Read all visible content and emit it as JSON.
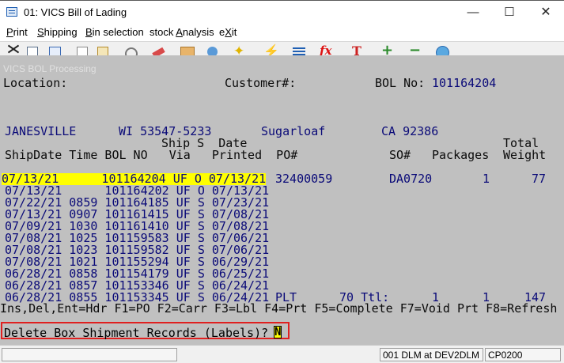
{
  "window": {
    "title": "01: VICS Bill of Lading",
    "minimize": "—",
    "maximize": "☐",
    "close": "✕"
  },
  "menu": {
    "print": {
      "acc": "P",
      "rest": "rint"
    },
    "shipping": {
      "acc": "S",
      "rest": "hipping"
    },
    "bin": {
      "acc": "B",
      "rest": "in selection"
    },
    "stock": {
      "pre": "stock ",
      "acc": "A",
      "rest": "nalysis"
    },
    "exit": {
      "pre": "e",
      "acc": "X",
      "rest": "it"
    }
  },
  "toolbar": [
    "scissors-icon",
    "copy-icon",
    "document-icon",
    "paste-icon",
    "clipboard-icon",
    "gear-icon",
    "eraser-icon",
    "box-icon",
    "users-icon",
    "star-icon",
    "bolt-icon",
    "lines-icon",
    "fx-icon",
    "text-icon",
    "plus-icon",
    "minus-icon",
    "globe-icon"
  ],
  "terminal": {
    "title": "VICS BOL Processing",
    "location_label": "Location:",
    "customer_label": "Customer#:",
    "bol_label": "BOL No:",
    "bol_value": "101164204",
    "from_city": "JANESVILLE",
    "from_state_zip": "WI 53547-5233",
    "to_name": "Sugarloaf",
    "to_state_zip": "CA 92386",
    "hdr_line1": "Ship S  Date",
    "hdr_total": "Total",
    "hdr_line2": "ShipDate Time BOL NO   Via   Printed  PO#",
    "hdr_so": "SO#",
    "hdr_packages": "Packages",
    "hdr_weight": "Weight",
    "rows": [
      {
        "text": "07/13/21      101164204 UF O 07/13/21",
        "po": "32400059",
        "so": "DA0720",
        "pkg": "1",
        "wt": "77"
      },
      {
        "text": "07/13/21      101164202 UF O 07/13/21"
      },
      {
        "text": "07/22/21 0859 101164185 UF S 07/23/21"
      },
      {
        "text": "07/13/21 0907 101161415 UF S 07/08/21"
      },
      {
        "text": "07/09/21 1030 101161410 UF S 07/08/21"
      },
      {
        "text": "07/08/21 1025 101159583 UF S 07/06/21"
      },
      {
        "text": "07/08/21 1023 101159582 UF S 07/06/21"
      },
      {
        "text": "07/08/21 1021 101155294 UF S 06/29/21"
      },
      {
        "text": "06/28/21 0858 101154179 UF S 06/25/21"
      },
      {
        "text": "06/28/21 0857 101153346 UF S 06/24/21"
      },
      {
        "text": "06/28/21 0855 101153345 UF S 06/24/21",
        "po": "PLT",
        "ttl": "70 Ttl:",
        "so_pkg": "1",
        "pkg": "1",
        "wt": "147"
      }
    ],
    "fkeys": "Ins,Del,Ent=Hdr F1=PO F2=Carr F3=Lbl F4=Prt F5=Complete F7=Void Prt F8=Refresh"
  },
  "prompt": {
    "text": "Delete Box Shipment Records (Labels)?",
    "value": "N"
  },
  "status": {
    "cell0": "",
    "cell1": "001 DLM at DEV2DLM",
    "cell2": "CP0200"
  }
}
